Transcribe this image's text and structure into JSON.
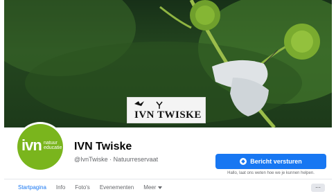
{
  "cover": {
    "logo_wordmark": "IVN TWISKE"
  },
  "profile": {
    "avatar_main": "ivn",
    "avatar_tag_line1": "natuur",
    "avatar_tag_line2": "educatie",
    "name": "IVN Twiske",
    "handle_line": "@IvnTwiske · Natuurreservaat"
  },
  "actions": {
    "message_button": "Bericht versturen",
    "message_hint": "Hallo, laat ons weten hoe we je kunnen helpen.",
    "more_button": "···"
  },
  "tabs": {
    "items": [
      {
        "label": "Startpagina"
      },
      {
        "label": "Info"
      },
      {
        "label": "Foto's"
      },
      {
        "label": "Evenementen"
      },
      {
        "label": "Meer"
      }
    ]
  },
  "colors": {
    "brand_blue": "#1877f2",
    "avatar_green": "#7ab51d"
  },
  "icons": [
    "messenger-icon",
    "caret-down-icon",
    "more-dots-icon"
  ]
}
